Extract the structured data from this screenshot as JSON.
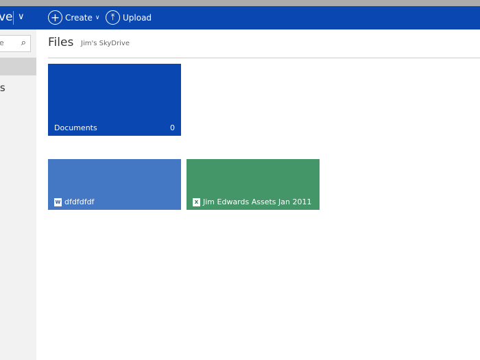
{
  "header": {
    "brand": "ve",
    "create_label": "Create",
    "upload_label": "Upload",
    "color": "#0b47b0"
  },
  "sidebar": {
    "search_placeholder": "e",
    "item": "ts"
  },
  "main": {
    "title": "Files",
    "breadcrumb": "Jim's SkyDrive"
  },
  "folders": [
    {
      "name": "Documents",
      "count": "0",
      "color": "#0b47b0"
    }
  ],
  "files": [
    {
      "name": "dfdfdfdf",
      "type": "word",
      "icon": "word-doc-icon",
      "color": "#4578c4"
    },
    {
      "name": "Jim Edwards Assets Jan 2011",
      "type": "excel",
      "icon": "excel-doc-icon",
      "color": "#449568"
    }
  ]
}
